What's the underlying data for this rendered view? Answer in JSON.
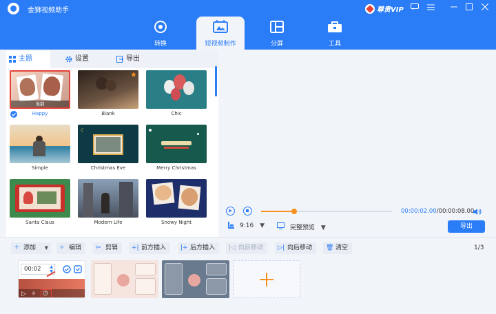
{
  "app": {
    "title": "金狮视频助手",
    "vip_label": "尊贵VIP"
  },
  "window_controls": [
    "chat-icon",
    "menu-icon",
    "minimize-icon",
    "maximize-icon",
    "close-icon"
  ],
  "main_tabs": [
    {
      "label": "转换",
      "icon": "disc-icon",
      "active": false
    },
    {
      "label": "短视频制作",
      "icon": "film-icon",
      "active": true
    },
    {
      "label": "分屏",
      "icon": "split-screen-icon",
      "active": false
    },
    {
      "label": "工具",
      "icon": "toolbox-icon",
      "active": false
    }
  ],
  "left_tabs": [
    {
      "label": "主题",
      "icon": "grid-icon",
      "active": true
    },
    {
      "label": "设置",
      "icon": "gear-icon",
      "active": false
    },
    {
      "label": "导出",
      "icon": "export-icon",
      "active": false
    }
  ],
  "themes": [
    {
      "name": "Happy",
      "badge": "当前",
      "selected": true
    },
    {
      "name": "Blank",
      "selected": false
    },
    {
      "name": "Chic",
      "selected": false
    },
    {
      "name": "Simple",
      "selected": false
    },
    {
      "name": "Christmas Eve",
      "selected": false
    },
    {
      "name": "Merry Christmas",
      "selected": false
    },
    {
      "name": "Santa Claus",
      "selected": false
    },
    {
      "name": "Modern Life",
      "selected": false
    },
    {
      "name": "Snowy Night",
      "selected": false
    }
  ],
  "player": {
    "current_time": "00:00:02.00",
    "total_time": "/00:00:08.00",
    "progress": 0.25,
    "ratio": "9:16",
    "preview_mode": "完整预览",
    "export_label": "导出"
  },
  "toolbar": {
    "add": "添加",
    "edit": "编辑",
    "cut": "剪辑",
    "insert_before": "前方插入",
    "insert_after": "后方插入",
    "move_forward": "向前移动",
    "move_backward": "向后移动",
    "clear": "清空",
    "page": "1/3"
  },
  "clip": {
    "duration": "00:02"
  },
  "colors": {
    "accent": "#2a7cf7",
    "orange": "#f7901e",
    "highlight": "#e5423a"
  }
}
